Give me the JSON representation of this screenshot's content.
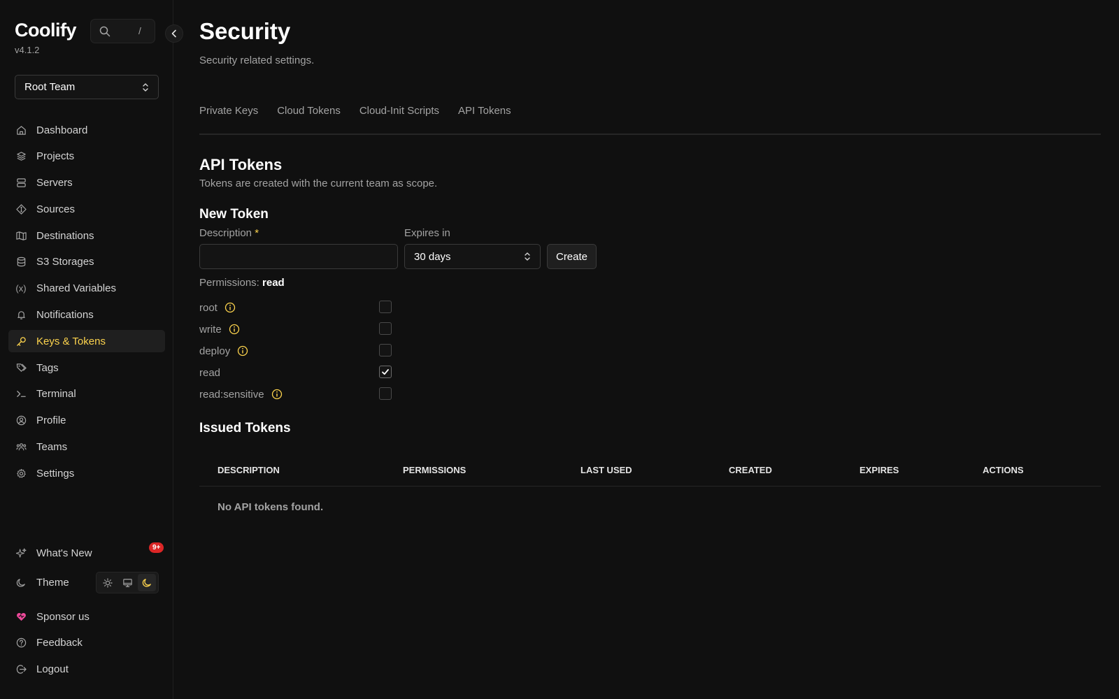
{
  "sidebar": {
    "brand": "Coolify",
    "version": "v4.1.2",
    "search_shortcut": "/",
    "team": "Root Team",
    "items": [
      {
        "label": "Dashboard",
        "icon": "home-icon"
      },
      {
        "label": "Projects",
        "icon": "layers-icon"
      },
      {
        "label": "Servers",
        "icon": "server-icon"
      },
      {
        "label": "Sources",
        "icon": "git-icon"
      },
      {
        "label": "Destinations",
        "icon": "map-icon"
      },
      {
        "label": "S3 Storages",
        "icon": "database-icon"
      },
      {
        "label": "Shared Variables",
        "icon": "variable-icon"
      },
      {
        "label": "Notifications",
        "icon": "bell-icon"
      },
      {
        "label": "Keys & Tokens",
        "icon": "key-icon",
        "active": true
      },
      {
        "label": "Tags",
        "icon": "tags-icon"
      },
      {
        "label": "Terminal",
        "icon": "terminal-icon"
      },
      {
        "label": "Profile",
        "icon": "user-circle-icon"
      },
      {
        "label": "Teams",
        "icon": "users-icon"
      },
      {
        "label": "Settings",
        "icon": "gear-icon"
      }
    ],
    "whats_new": "What's New",
    "whats_new_badge": "9+",
    "theme": "Theme",
    "sponsor": "Sponsor us",
    "feedback": "Feedback",
    "logout": "Logout"
  },
  "page": {
    "title": "Security",
    "subtitle": "Security related settings.",
    "tabs": [
      "Private Keys",
      "Cloud Tokens",
      "Cloud-Init Scripts",
      "API Tokens"
    ],
    "section_title": "API Tokens",
    "section_sub": "Tokens are created with the current team as scope.",
    "new_token_title": "New Token",
    "description_label": "Description",
    "required_mark": "*",
    "description_value": "",
    "expires_label": "Expires in",
    "expires_value": "30 days",
    "create_label": "Create",
    "permissions_label": "Permissions:",
    "permissions_value": "read",
    "permissions": [
      {
        "name": "root",
        "info": true,
        "checked": false
      },
      {
        "name": "write",
        "info": true,
        "checked": false
      },
      {
        "name": "deploy",
        "info": true,
        "checked": false
      },
      {
        "name": "read",
        "info": false,
        "checked": true
      },
      {
        "name": "read:sensitive",
        "info": true,
        "checked": false
      }
    ],
    "issued_title": "Issued Tokens",
    "table_columns": [
      "DESCRIPTION",
      "PERMISSIONS",
      "LAST USED",
      "CREATED",
      "EXPIRES",
      "ACTIONS"
    ],
    "empty_message": "No API tokens found."
  },
  "colors": {
    "accent": "#fcd34d",
    "background": "#101010",
    "badge": "#dc2626",
    "sponsor_heart": "#ec4899"
  }
}
